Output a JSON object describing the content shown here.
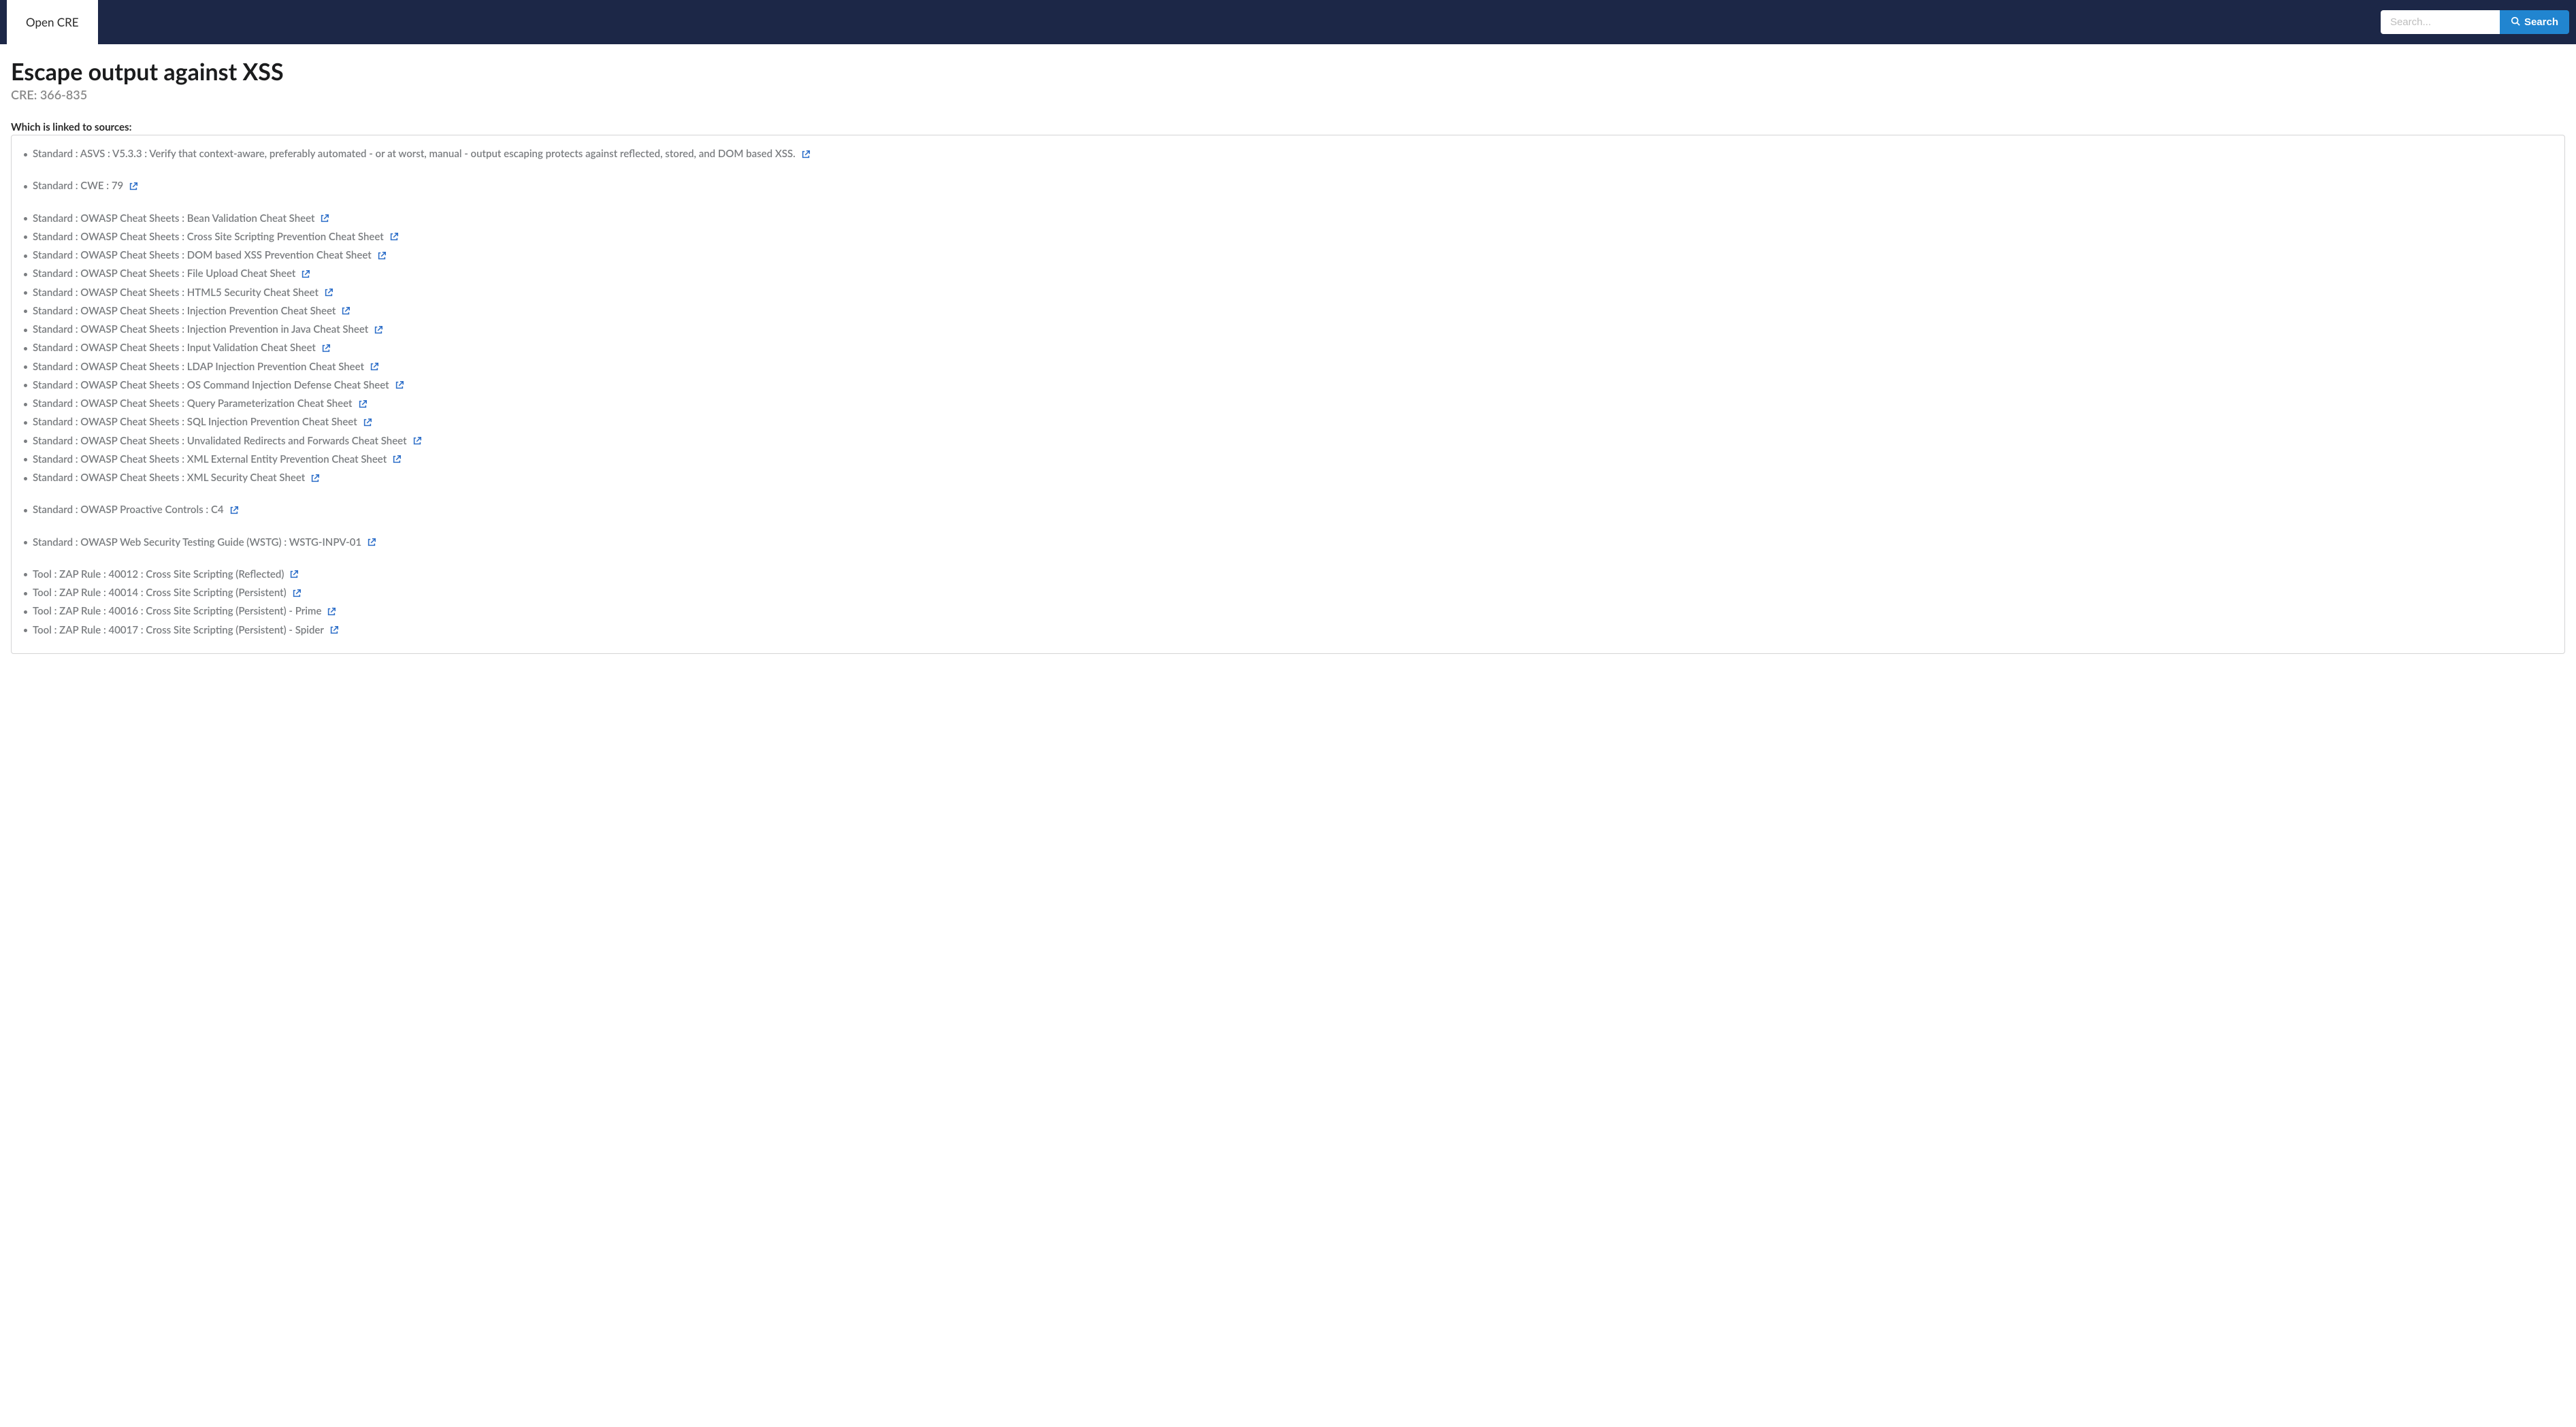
{
  "header": {
    "brand": "Open CRE",
    "search": {
      "placeholder": "Search...",
      "button_label": "Search"
    }
  },
  "page": {
    "title": "Escape output against XSS",
    "subtitle": "CRE: 366-835",
    "linked_label": "Which is linked to sources"
  },
  "groups": [
    {
      "items": [
        "Standard : ASVS : V5.3.3 : Verify that context-aware, preferably automated - or at worst, manual - output escaping protects against reflected, stored, and DOM based XSS."
      ]
    },
    {
      "items": [
        "Standard : CWE : 79"
      ]
    },
    {
      "items": [
        "Standard : OWASP Cheat Sheets : Bean Validation Cheat Sheet",
        "Standard : OWASP Cheat Sheets : Cross Site Scripting Prevention Cheat Sheet",
        "Standard : OWASP Cheat Sheets : DOM based XSS Prevention Cheat Sheet",
        "Standard : OWASP Cheat Sheets : File Upload Cheat Sheet",
        "Standard : OWASP Cheat Sheets : HTML5 Security Cheat Sheet",
        "Standard : OWASP Cheat Sheets : Injection Prevention Cheat Sheet",
        "Standard : OWASP Cheat Sheets : Injection Prevention in Java Cheat Sheet",
        "Standard : OWASP Cheat Sheets : Input Validation Cheat Sheet",
        "Standard : OWASP Cheat Sheets : LDAP Injection Prevention Cheat Sheet",
        "Standard : OWASP Cheat Sheets : OS Command Injection Defense Cheat Sheet",
        "Standard : OWASP Cheat Sheets : Query Parameterization Cheat Sheet",
        "Standard : OWASP Cheat Sheets : SQL Injection Prevention Cheat Sheet",
        "Standard : OWASP Cheat Sheets : Unvalidated Redirects and Forwards Cheat Sheet",
        "Standard : OWASP Cheat Sheets : XML External Entity Prevention Cheat Sheet",
        "Standard : OWASP Cheat Sheets : XML Security Cheat Sheet"
      ]
    },
    {
      "items": [
        "Standard : OWASP Proactive Controls : C4"
      ]
    },
    {
      "items": [
        "Standard : OWASP Web Security Testing Guide (WSTG) : WSTG-INPV-01"
      ]
    },
    {
      "items": [
        "Tool : ZAP Rule : 40012 : Cross Site Scripting (Reflected)",
        "Tool : ZAP Rule : 40014 : Cross Site Scripting (Persistent)",
        "Tool : ZAP Rule : 40016 : Cross Site Scripting (Persistent) - Prime",
        "Tool : ZAP Rule : 40017 : Cross Site Scripting (Persistent) - Spider"
      ]
    }
  ]
}
